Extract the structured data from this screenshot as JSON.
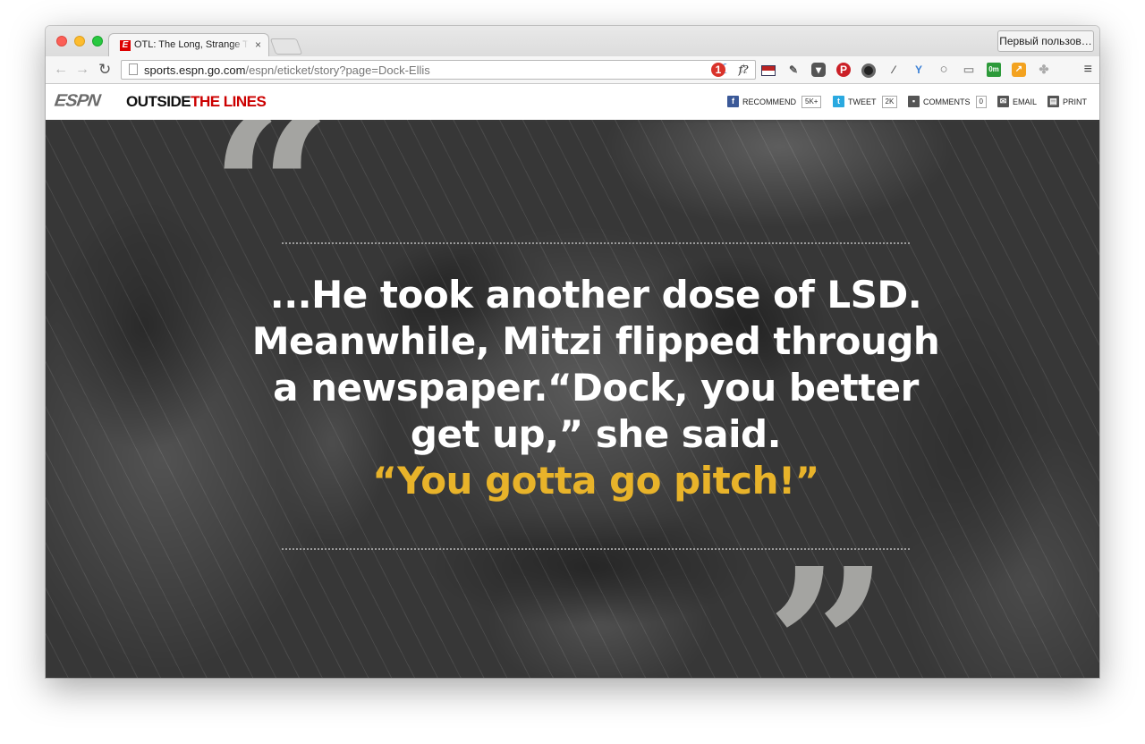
{
  "browser": {
    "tab_title": "OTL: The Long, Strange Tri",
    "tab_close": "×",
    "profile_button": "Первый пользов…",
    "url_host": "sports.espn.go.com",
    "url_path": "/espn/eticket/story?page=Dock-Ellis",
    "ext_f_label": "f?",
    "ext_badge_count": "1",
    "ext_timer": "0m"
  },
  "site": {
    "espn_logo": "ESPN",
    "otl_part1": "OUTSIDE",
    "otl_part2": "THE LINES",
    "share": {
      "recommend_label": "RECOMMEND",
      "recommend_count": "5K+",
      "tweet_label": "TWEET",
      "tweet_count": "2K",
      "comments_label": "COMMENTS",
      "comments_count": "0",
      "email_label": "EMAIL",
      "print_label": "PRINT"
    }
  },
  "quote": {
    "open_mark": "“",
    "close_mark": "”",
    "line1": "...He took another dose of LSD.",
    "line2": "Meanwhile, Mitzi flipped through",
    "line3": "a newspaper.“Dock, you better",
    "line4": "get up,” she said.",
    "line5": "“You gotta go pitch!”",
    "accent_color": "#e8b32a"
  }
}
